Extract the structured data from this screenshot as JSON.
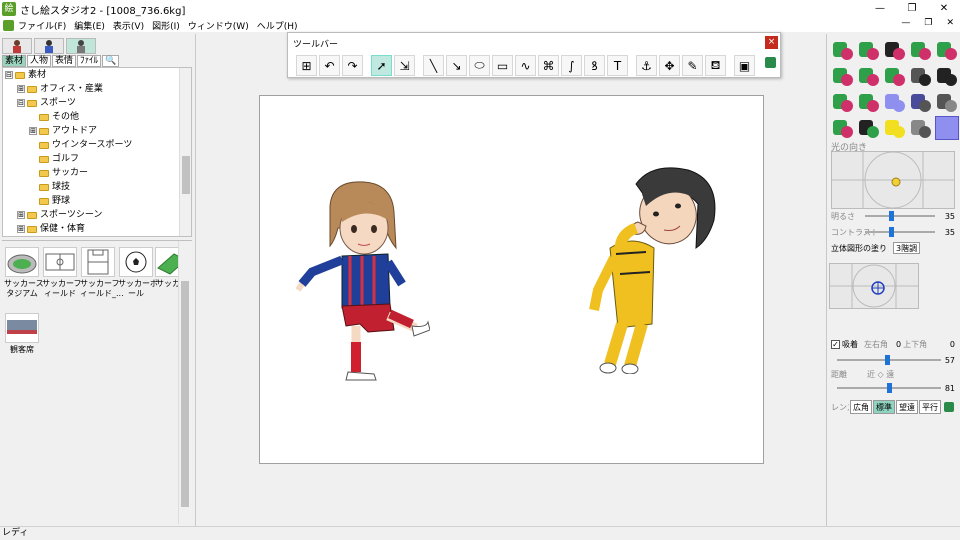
{
  "window": {
    "title": "さし絵スタジオ2 - [1008_736.6kg]",
    "minimize": "—",
    "restore": "❐",
    "close": "✕"
  },
  "menu": {
    "items": [
      "ファイル(F)",
      "編集(E)",
      "表示(V)",
      "図形(I)",
      "ウィンドウ(W)",
      "ヘルプ(H)"
    ],
    "mdi": {
      "minimize": "—",
      "restore": "❐",
      "close": "✕"
    }
  },
  "left": {
    "tabs": [
      "素材",
      "人物",
      "表情",
      "ﾌｧｲﾙ",
      "🔍"
    ],
    "tree": [
      {
        "label": "素材",
        "level": 0,
        "expander": "⊟"
      },
      {
        "label": "オフィス・産業",
        "level": 1,
        "expander": "⊞"
      },
      {
        "label": "スポーツ",
        "level": 1,
        "expander": "⊟"
      },
      {
        "label": "その他",
        "level": 2,
        "expander": ""
      },
      {
        "label": "アウトドア",
        "level": 2,
        "expander": "⊞"
      },
      {
        "label": "ウインタースポーツ",
        "level": 2,
        "expander": ""
      },
      {
        "label": "ゴルフ",
        "level": 2,
        "expander": ""
      },
      {
        "label": "サッカー",
        "level": 2,
        "expander": ""
      },
      {
        "label": "球技",
        "level": 2,
        "expander": ""
      },
      {
        "label": "野球",
        "level": 2,
        "expander": ""
      },
      {
        "label": "スポーツシーン",
        "level": 1,
        "expander": "⊞"
      },
      {
        "label": "保健・体育",
        "level": 1,
        "expander": "⊞"
      }
    ],
    "thumbnails": [
      {
        "label": "サッカース\nタジアム"
      },
      {
        "label": "サッカーフ\nィールド"
      },
      {
        "label": "サッカーフ\nィールド_..."
      },
      {
        "label": "サッカーボ\nール"
      },
      {
        "label": "サッカー"
      },
      {
        "label": "観客席"
      }
    ]
  },
  "toolbar": {
    "title": "ツールバー",
    "close": "×",
    "tools": [
      {
        "icon": "select-all-icon",
        "glyph": "⊞"
      },
      {
        "icon": "undo-icon",
        "glyph": "↶"
      },
      {
        "icon": "redo-icon",
        "glyph": "↷"
      },
      {
        "icon": "pointer-icon",
        "glyph": "➚",
        "active": true
      },
      {
        "icon": "node-select-icon",
        "glyph": "⇲"
      },
      {
        "icon": "line-icon",
        "glyph": "╲"
      },
      {
        "icon": "arrow-line-icon",
        "glyph": "↘"
      },
      {
        "icon": "ellipse-icon",
        "glyph": "⬭"
      },
      {
        "icon": "rectangle-icon",
        "glyph": "▭"
      },
      {
        "icon": "polyline-icon",
        "glyph": "∿"
      },
      {
        "icon": "polygon-icon",
        "glyph": "⌘"
      },
      {
        "icon": "curve-icon",
        "glyph": "∫"
      },
      {
        "icon": "closed-curve-icon",
        "glyph": "ꝸ"
      },
      {
        "icon": "text-icon",
        "glyph": "T"
      },
      {
        "icon": "pose-icon",
        "glyph": "⚓"
      },
      {
        "icon": "move-icon",
        "glyph": "✥"
      },
      {
        "icon": "eyedropper-icon",
        "glyph": "✎"
      },
      {
        "icon": "paint-bucket-icon",
        "glyph": "⛾"
      },
      {
        "icon": "properties-icon",
        "glyph": "▣"
      }
    ]
  },
  "right": {
    "light_section": "光の向き",
    "brightness": {
      "label": "明るさ",
      "value": "35"
    },
    "contrast": {
      "label": "コントラスト",
      "value": "35"
    },
    "shading": {
      "label": "立体図形の塗り",
      "value": "3階調"
    },
    "snap": {
      "label": "吸着",
      "checked": true
    },
    "lr_angle": {
      "label": "左右角",
      "value": "0"
    },
    "ud_angle": {
      "label": "上下角",
      "value": "0"
    },
    "ud_value": "57",
    "distance": {
      "label": "距離",
      "near_far": "近 ◇ 遠",
      "value": "81"
    },
    "lens": {
      "label": "レンズ",
      "options": [
        "広角",
        "標準",
        "望遠",
        "平行"
      ],
      "selected": "標準"
    }
  },
  "status": {
    "text": "レディ"
  },
  "colors": {
    "accent": "#9ad4bd",
    "title_close": "#c42b1c",
    "selected_material": "#8f8fef"
  }
}
